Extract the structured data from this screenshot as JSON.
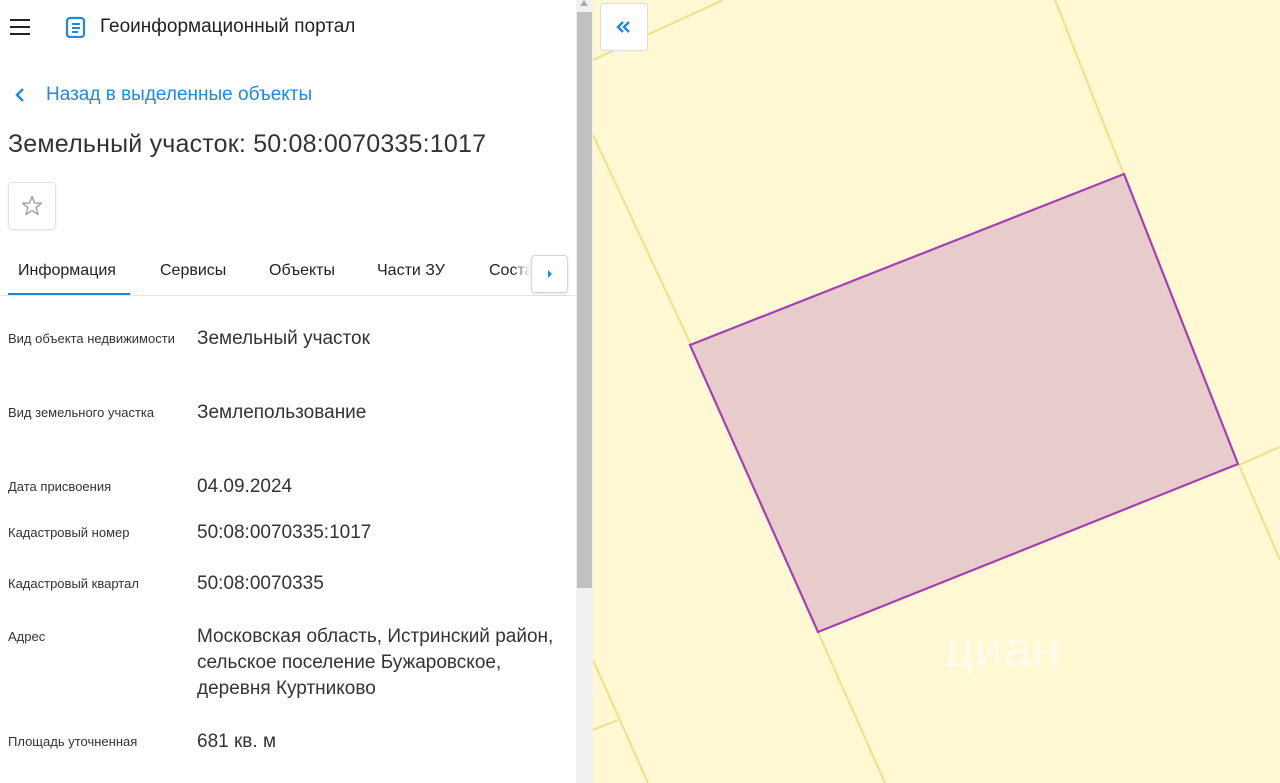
{
  "header": {
    "app_title": "Геоинформационный портал",
    "menu_icon": "hamburger-menu-icon",
    "logo_icon": "portal-logo-icon"
  },
  "back_link": {
    "label": "Назад в выделенные объекты",
    "icon": "chevron-left-icon"
  },
  "object_title": "Земельный участок: 50:08:0070335:1017",
  "favorite_icon": "star-outline-icon",
  "tabs": [
    {
      "label": "Информация",
      "active": true
    },
    {
      "label": "Сервисы",
      "active": false
    },
    {
      "label": "Объекты",
      "active": false
    },
    {
      "label": "Части ЗУ",
      "active": false
    },
    {
      "label": "Состав",
      "active": false
    }
  ],
  "properties": [
    {
      "label": "Вид объекта недвижимости",
      "value": "Земельный участок"
    },
    {
      "label": "Вид земельного участка",
      "value": "Землепользование"
    },
    {
      "label": "Дата присвоения",
      "value": "04.09.2024"
    },
    {
      "label": "Кадастровый номер",
      "value": "50:08:0070335:1017"
    },
    {
      "label": "Кадастровый квартал",
      "value": "50:08:0070335"
    },
    {
      "label": "Адрес",
      "value": "Московская область, Истринский район, сельское поселение Бужаровское, деревня Куртниково"
    },
    {
      "label": "Площадь уточненная",
      "value": "681 кв. м"
    }
  ],
  "map": {
    "collapse_icon": "double-chevron-left-icon",
    "watermark": "циан",
    "parcel_fill": "#e8cbcb",
    "parcel_stroke": "#a63fb3",
    "background": "#fef9d2",
    "boundary_color": "#f0e08a"
  },
  "colors": {
    "accent": "#1e88e5"
  }
}
